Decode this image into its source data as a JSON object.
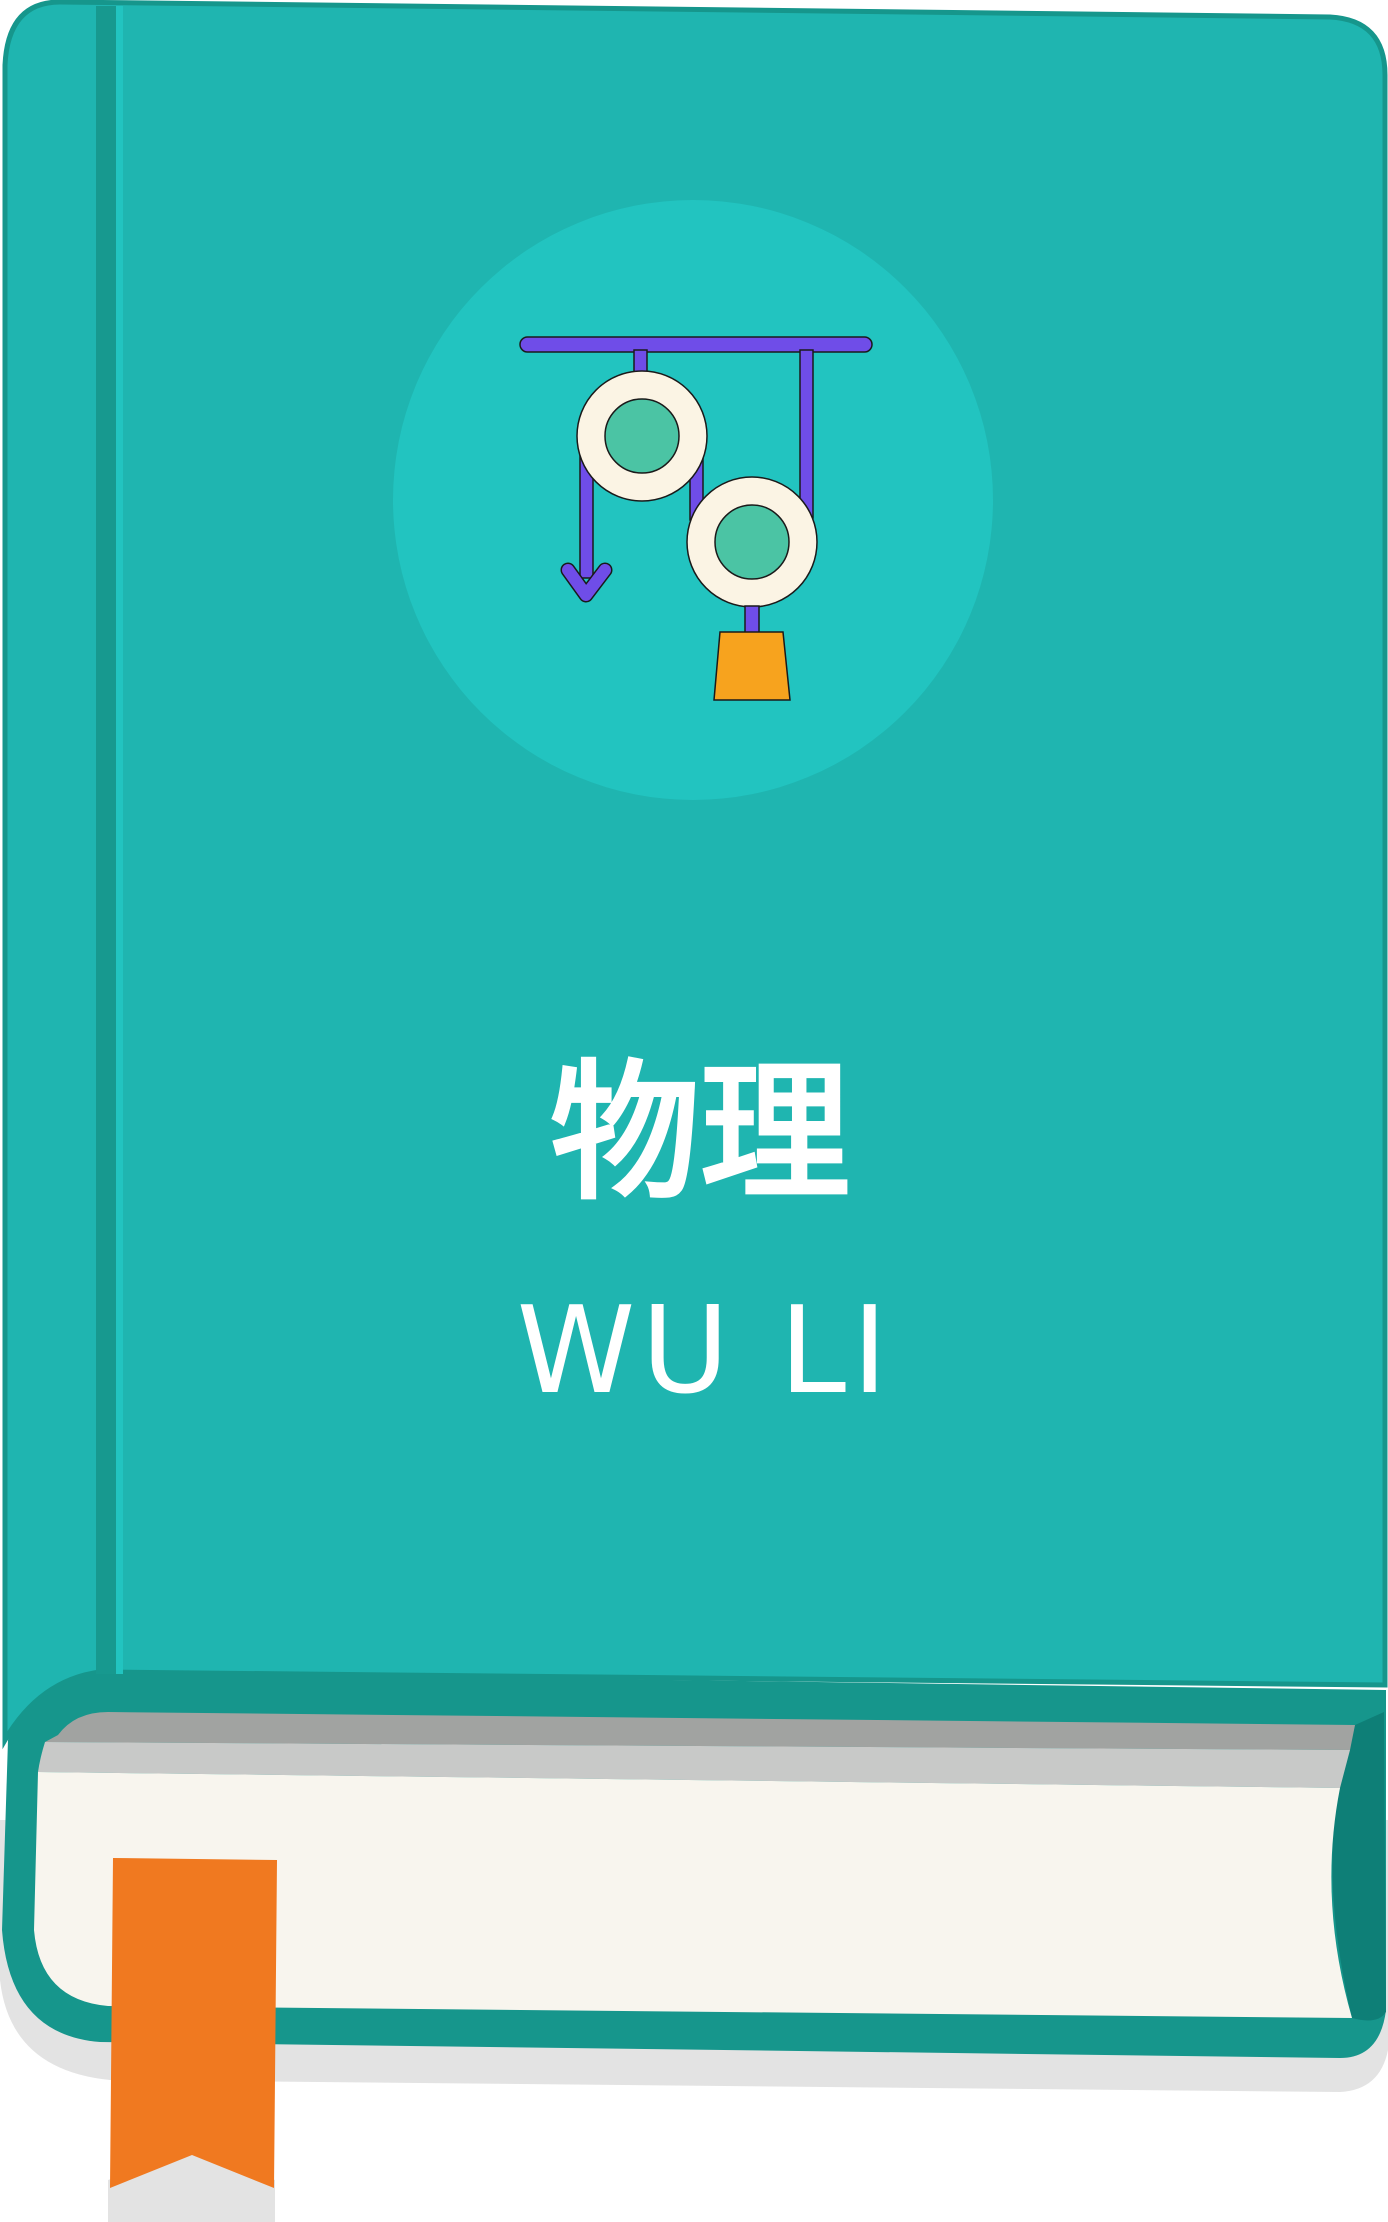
{
  "book": {
    "title": "物理",
    "subtitle": "WU LI",
    "icon": "pulley-system-icon",
    "colors": {
      "cover": "#1fb5b0",
      "cover_border": "#16968c",
      "spine": "#17998f",
      "emblem_circle": "#22c4c0",
      "pages": "#f8f5ee",
      "page_edge_gray": "#c8c9c8",
      "page_edge_dark": "#a1a3a1",
      "bookmark": "#f07920",
      "shadow": "#e3e3e3",
      "pulley_frame": "#6f4de8",
      "pulley_wheel": "#fbf4e4",
      "pulley_hub": "#4bc4a4",
      "weight": "#f7a31e"
    }
  }
}
